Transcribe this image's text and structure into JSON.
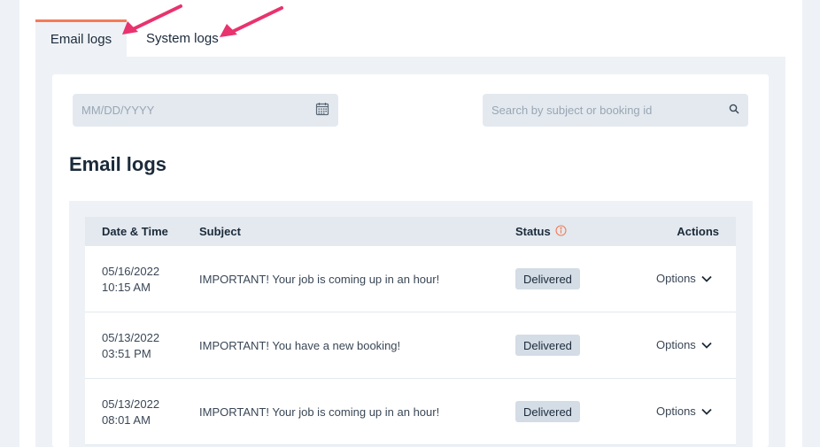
{
  "tabs": [
    {
      "label": "Email logs",
      "active": true
    },
    {
      "label": "System logs",
      "active": false
    }
  ],
  "filters": {
    "date_placeholder": "MM/DD/YYYY",
    "search_placeholder": "Search by subject or booking id"
  },
  "page_title": "Email logs",
  "table": {
    "headers": {
      "date": "Date & Time",
      "subject": "Subject",
      "status": "Status",
      "actions": "Actions"
    },
    "rows": [
      {
        "date": "05/16/2022",
        "time": "10:15 AM",
        "subject": "IMPORTANT! Your job is coming up in an hour!",
        "status": "Delivered",
        "action": "Options"
      },
      {
        "date": "05/13/2022",
        "time": "03:51 PM",
        "subject": "IMPORTANT! You have a new booking!",
        "status": "Delivered",
        "action": "Options"
      },
      {
        "date": "05/13/2022",
        "time": "08:01 AM",
        "subject": "IMPORTANT! Your job is coming up in an hour!",
        "status": "Delivered",
        "action": "Options"
      }
    ]
  },
  "colors": {
    "accent": "#f47b56",
    "annotation_arrow": "#e8336e",
    "text": "#1b2a3a"
  }
}
